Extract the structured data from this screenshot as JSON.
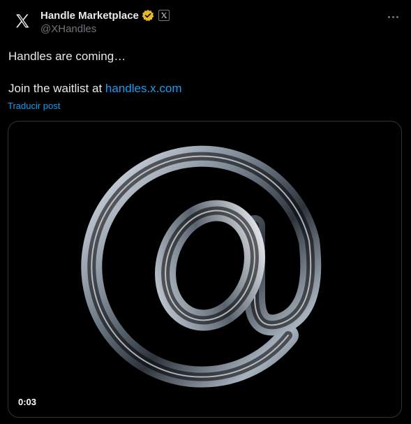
{
  "account": {
    "avatar_icon": "x-logo-icon",
    "display_name": "Handle Marketplace",
    "verified_icon": "gold-verified-badge-icon",
    "affiliate_icon": "x-affiliate-badge-icon",
    "handle": "@XHandles"
  },
  "more_icon": "more-horizontal-icon",
  "post": {
    "line1": "Handles are coming…",
    "line2_prefix": "Join the waitlist at ",
    "link_text": "handles.x.com",
    "translate_label": "Traducir post"
  },
  "media": {
    "image_icon": "at-sign-glass-icon",
    "timestamp": "0:03"
  },
  "colors": {
    "background": "#000000",
    "text": "#e7e9ea",
    "secondary": "#71767b",
    "link": "#1d9bf0",
    "verified_gold": "#e8b829",
    "border": "#2f3336"
  }
}
